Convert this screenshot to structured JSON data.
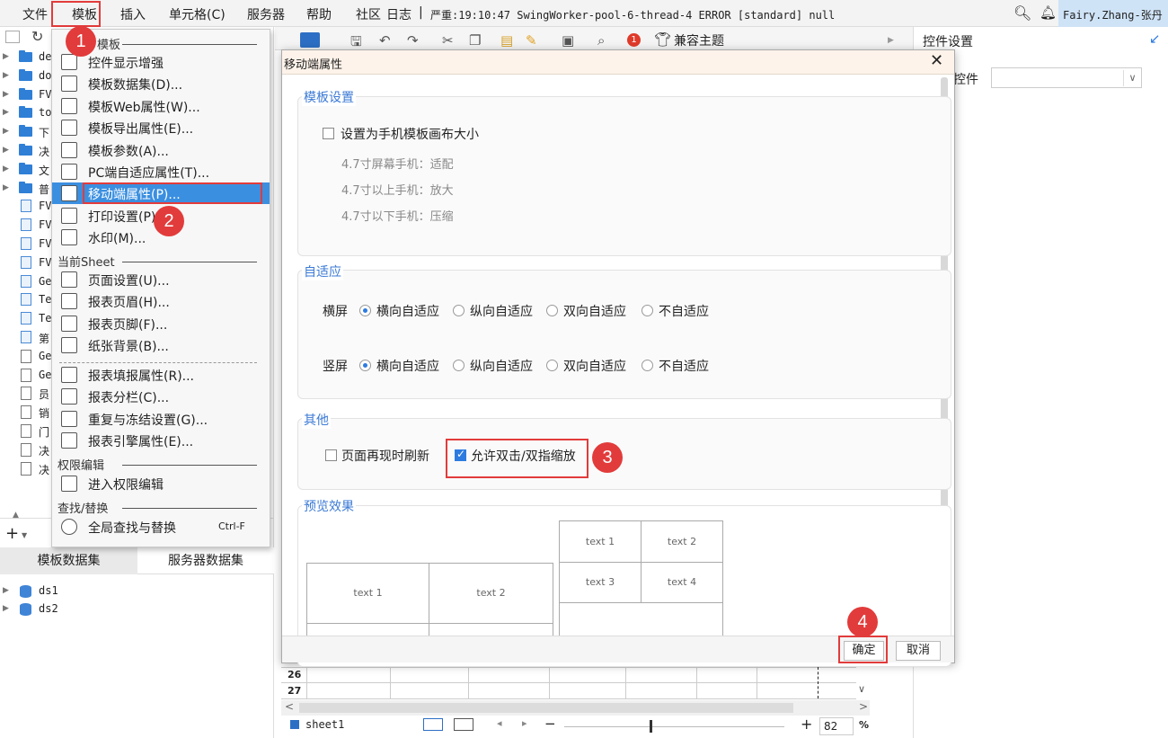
{
  "menubar": {
    "items": [
      "文件",
      "模板",
      "插入",
      "单元格(C)",
      "服务器",
      "帮助",
      "社区",
      "日志"
    ],
    "separator": "|",
    "log_message": "严重:19:10:47 SwingWorker-pool-6-thread-4 ERROR [standard] null",
    "user": "Fairy.Zhang-张丹"
  },
  "tree": {
    "items": [
      {
        "label": "de",
        "type": "folder"
      },
      {
        "label": "do",
        "type": "folder"
      },
      {
        "label": "FV",
        "type": "folder"
      },
      {
        "label": "to",
        "type": "folder"
      },
      {
        "label": "下",
        "type": "folder"
      },
      {
        "label": "决",
        "type": "folder"
      },
      {
        "label": "文",
        "type": "folder"
      },
      {
        "label": "普",
        "type": "folder"
      },
      {
        "label": "FV",
        "type": "cpt"
      },
      {
        "label": "FV",
        "type": "cpt"
      },
      {
        "label": "FV",
        "type": "cpt"
      },
      {
        "label": "FV",
        "type": "cpt"
      },
      {
        "label": "Ge",
        "type": "cpt"
      },
      {
        "label": "Te",
        "type": "cpt"
      },
      {
        "label": "Te",
        "type": "cpt"
      },
      {
        "label": "第",
        "type": "cpt"
      },
      {
        "label": "Ge",
        "type": "doc"
      },
      {
        "label": "Ge",
        "type": "doc"
      },
      {
        "label": "员",
        "type": "doc"
      },
      {
        "label": "销",
        "type": "doc"
      },
      {
        "label": "门",
        "type": "doc"
      },
      {
        "label": "决",
        "type": "doc"
      },
      {
        "label": "决",
        "type": "doc"
      }
    ]
  },
  "datasets": {
    "tabs": [
      "模板数据集",
      "服务器数据集"
    ],
    "items": [
      "ds1",
      "ds2"
    ]
  },
  "dropdown": {
    "section_template": "模板",
    "items_a": [
      {
        "label": "控件显示增强",
        "icon": "widget-display-icon"
      },
      {
        "label": "模板数据集(D)...",
        "icon": "database-icon"
      },
      {
        "label": "模板Web属性(W)...",
        "icon": "globe-icon"
      },
      {
        "label": "模板导出属性(E)...",
        "icon": "export-icon"
      },
      {
        "label": "模板参数(A)...",
        "icon": "parameter-icon"
      },
      {
        "label": "PC端自适应属性(T)...",
        "icon": "resize-icon"
      },
      {
        "label": "移动端属性(P)...",
        "icon": "mobile-icon"
      },
      {
        "label": "打印设置(P)",
        "icon": "printer-icon"
      },
      {
        "label": "水印(M)...",
        "icon": "stamp-icon"
      }
    ],
    "section_sheet": "当前Sheet",
    "items_b": [
      {
        "label": "页面设置(U)...",
        "icon": "page-setup-icon"
      },
      {
        "label": "报表页眉(H)...",
        "icon": "header-icon"
      },
      {
        "label": "报表页脚(F)...",
        "icon": "footer-icon"
      },
      {
        "label": "纸张背景(B)...",
        "icon": "image-icon"
      }
    ],
    "items_c": [
      {
        "label": "报表填报属性(R)...",
        "icon": "form-icon"
      },
      {
        "label": "报表分栏(C)...",
        "icon": "columns-icon"
      },
      {
        "label": "重复与冻结设置(G)...",
        "icon": "freeze-icon"
      },
      {
        "label": "报表引擎属性(E)...",
        "icon": "engine-icon"
      }
    ],
    "section_permission": "权限编辑",
    "item_permission": "进入权限编辑",
    "section_find": "查找/替换",
    "item_find": "全局查找与替换",
    "item_find_shortcut": "Ctrl-F"
  },
  "toolbar": {
    "badge_count": "1",
    "theme_label": "兼容主题"
  },
  "right_panel": {
    "title": "控件设置",
    "field_label": "控件"
  },
  "dialog": {
    "title": "移动端属性",
    "template_group": {
      "title": "模板设置",
      "checkbox_label": "设置为手机模板画布大小",
      "checked": false,
      "hints": [
        "4.7寸屏幕手机：适配",
        "4.7寸以上手机：放大",
        "4.7寸以下手机：压缩"
      ]
    },
    "adapt_group": {
      "title": "自适应",
      "rows": [
        {
          "label": "横屏",
          "selected": 0
        },
        {
          "label": "竖屏",
          "selected": 0
        }
      ],
      "options": [
        "横向自适应",
        "纵向自适应",
        "双向自适应",
        "不自适应"
      ]
    },
    "other_group": {
      "title": "其他",
      "refresh_label": "页面再现时刷新",
      "refresh_checked": false,
      "zoom_label": "允许双击/双指缩放",
      "zoom_checked": true
    },
    "preview_group": {
      "title": "预览效果",
      "big_cells": [
        "text 1",
        "text 2"
      ],
      "small_cells": [
        "text 1",
        "text 2",
        "text 3",
        "text 4"
      ]
    },
    "ok_label": "确定",
    "cancel_label": "取消"
  },
  "annotations": {
    "badges": [
      "1",
      "2",
      "3",
      "4"
    ]
  },
  "sheet": {
    "rows": [
      "26",
      "27"
    ],
    "tab": "sheet1",
    "zoom": "82",
    "zoom_unit": "%"
  }
}
